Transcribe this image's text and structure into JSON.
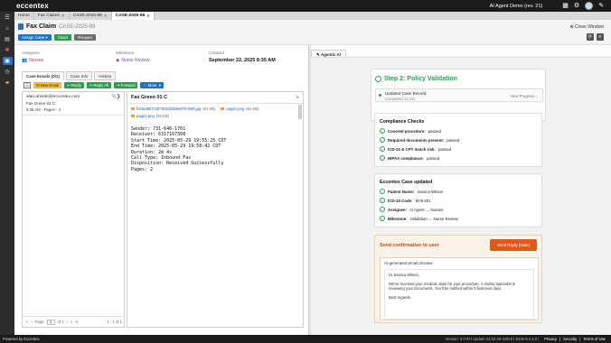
{
  "app": {
    "logo": "eccentex",
    "org": "AI Agent Demo (rev. 21)"
  },
  "tabs": [
    {
      "label": "Home",
      "closable": false
    },
    {
      "label": "Fax Claims",
      "closable": true
    },
    {
      "label": "CASE-2025-98",
      "closable": true
    },
    {
      "label": "CASE-2025-98",
      "closable": true
    }
  ],
  "header": {
    "title": "Fax Claim",
    "case_id": "CASE-2025-98",
    "close_window": "Close Window",
    "assign_case": "Assign Case",
    "claim": "Claim",
    "reopen": "Reopen"
  },
  "meta": {
    "assignee_label": "Assignee",
    "assignee": "Nurses",
    "milestone_label": "Milestone",
    "milestone": "Nurse Review",
    "created_label": "Created",
    "created": "September 22, 2025 8:35 AM"
  },
  "subtabs": [
    "Case Emails (0/1)",
    "Case Info",
    "History"
  ],
  "toolbar": {
    "new_email": "New Email",
    "reply": "Reply",
    "reply_all": "Reply All",
    "forward": "Forward",
    "more": "More"
  },
  "email_list": {
    "items": [
      {
        "from": "alan.ahonle@eccentex.com",
        "subject": "Fax Green 01 C",
        "time": "8:35 AM - Pages - 4"
      }
    ],
    "pager": {
      "page_label": "Page",
      "page": "1",
      "of_label": "of 1",
      "count": "1 - 1 of 1"
    }
  },
  "email_view": {
    "subject": "Fax Green 01 C",
    "attachments": [
      {
        "name": "h2daa857c2d79c8d29b8e97fc4b6f.jpg",
        "size": "(51 KB)"
      },
      {
        "name": "page1.png",
        "size": "(52 KB)"
      },
      {
        "name": "page2.png",
        "size": "(53 KB)"
      }
    ],
    "body": "Sender: 731-646-1701\nReceiver: 6317167308\nStart Time: 2025-05-29 19:55:25 CDT\nEnd Time: 2025-05-29 19:58:42 CDT\nDuration: 2m 4s\nCall Type: Inbound Fax\nDisposition: Received Successfully\nPages: 2"
  },
  "agent": {
    "tab_label": "Agentic AI",
    "step_title": "Step 2: Policy Validation",
    "updated_record": "Updated Case Record",
    "updated_sub": "Completed 11:24s",
    "view_progress": "View Progress",
    "compliance_title": "Compliance Checks",
    "checks": [
      {
        "name": "Covered procedure:",
        "value": "passed"
      },
      {
        "name": "Required documents present:",
        "value": "passed"
      },
      {
        "name": "ICD-10 & CPT match risk:",
        "value": "passed"
      },
      {
        "name": "HIPAA compliance:",
        "value": "passed"
      }
    ],
    "case_updated_title": "Eccentex Case updated",
    "updates": [
      {
        "name": "Patient Name:",
        "value": "Jessica Wilson"
      },
      {
        "name": "ICD-10 Code:",
        "value": "M79.601"
      },
      {
        "name": "Assignee:",
        "value": "AI Agent → Nurses"
      },
      {
        "name": "Milestone:",
        "value": "Validation → Nurse Review"
      }
    ],
    "send_title": "Send confirmation to user",
    "send_button": "Send Reply (Date)",
    "preview_label": "AI-generated email preview:",
    "greeting": "Hi Jessica Wilson,",
    "body": "We've received your medical claim for your procedure. A claims specialist is reviewing your documents. You'll be notified within 3 business days.",
    "signoff": "Best regards,"
  },
  "footer": {
    "powered": "Powered by Eccentex",
    "version": "Version: 0.0 RH Update 23.02.28-42916 | DCM 8.4.4.0 |",
    "links": [
      "Privacy",
      "Security",
      "Terms of Use"
    ]
  },
  "colors": {
    "accent": "#1e73c8",
    "success": "#2e9b4f",
    "warning": "#e2571a"
  }
}
